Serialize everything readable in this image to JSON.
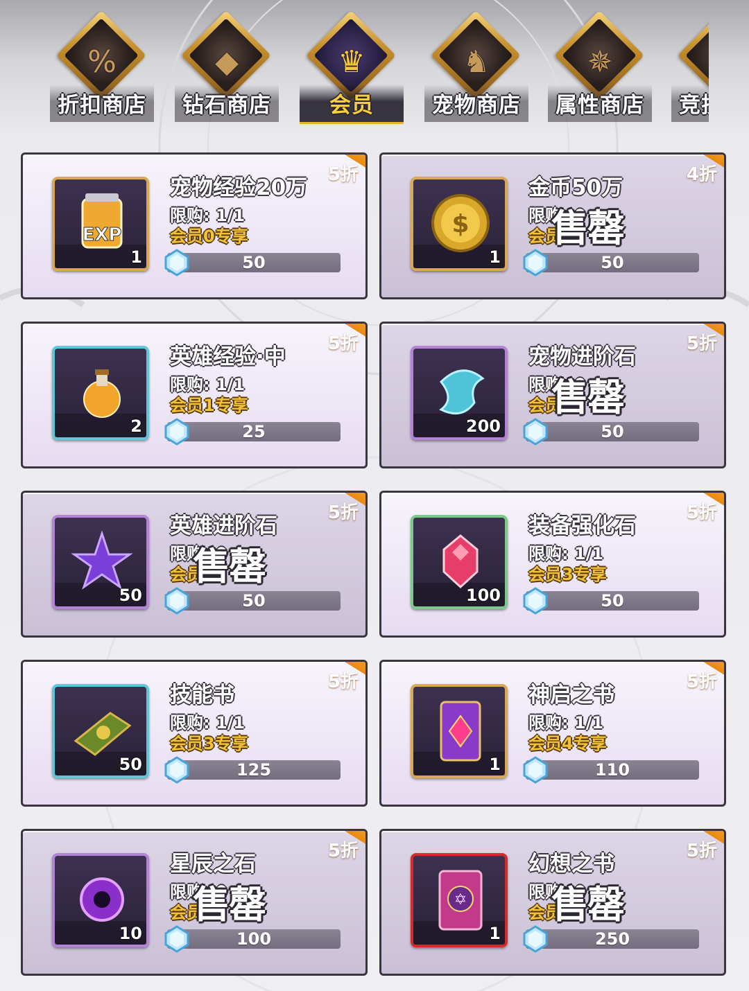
{
  "tabs": [
    {
      "label": "折扣商店",
      "icon": "discount-shop-icon",
      "glyph": "%",
      "active": false
    },
    {
      "label": "钻石商店",
      "icon": "diamond-shop-icon",
      "glyph": "◆",
      "active": false
    },
    {
      "label": "会员",
      "icon": "crown-icon",
      "glyph": "♛",
      "active": true
    },
    {
      "label": "宠物商店",
      "icon": "pet-shop-icon",
      "glyph": "♞",
      "active": false
    },
    {
      "label": "属性商店",
      "icon": "attribute-shop-icon",
      "glyph": "✵",
      "active": false
    },
    {
      "label": "竞技商店",
      "icon": "arena-shop-icon",
      "glyph": "⚔",
      "active": false
    }
  ],
  "items": [
    {
      "name": "宠物经验20万",
      "discount": "5折",
      "limit": "限购: 1/1",
      "vip": "会员0专享",
      "qty": "1",
      "price": "50",
      "sold_out": false,
      "frame": "gold",
      "icon": "exp-jar-icon"
    },
    {
      "name": "金币50万",
      "discount": "4折",
      "limit": "限购: 0",
      "vip": "会员",
      "qty": "1",
      "price": "50",
      "sold_out": true,
      "sold_text": "售罄",
      "frame": "gold",
      "icon": "gold-coin-icon"
    },
    {
      "name": "英雄经验·中",
      "discount": "5折",
      "limit": "限购: 1/1",
      "vip": "会员1专享",
      "qty": "2",
      "price": "25",
      "sold_out": false,
      "frame": "teal",
      "icon": "exp-potion-icon"
    },
    {
      "name": "宠物进阶石",
      "discount": "5折",
      "limit": "限购: 0",
      "vip": "会员",
      "qty": "200",
      "price": "50",
      "sold_out": true,
      "sold_text": "售罄",
      "frame": "purple",
      "icon": "pet-advance-stone-icon"
    },
    {
      "name": "英雄进阶石",
      "discount": "5折",
      "limit": "限购: 0",
      "vip": "会员",
      "qty": "50",
      "price": "50",
      "sold_out": true,
      "sold_text": "售罄",
      "frame": "purple",
      "icon": "hero-advance-stone-icon"
    },
    {
      "name": "装备强化石",
      "discount": "5折",
      "limit": "限购: 1/1",
      "vip": "会员3专享",
      "qty": "100",
      "price": "50",
      "sold_out": false,
      "frame": "green",
      "icon": "enhance-gem-icon"
    },
    {
      "name": "技能书",
      "discount": "5折",
      "limit": "限购: 1/1",
      "vip": "会员3专享",
      "qty": "50",
      "price": "125",
      "sold_out": false,
      "frame": "teal",
      "icon": "skill-book-icon"
    },
    {
      "name": "神启之书",
      "discount": "5折",
      "limit": "限购: 1/1",
      "vip": "会员4专享",
      "qty": "1",
      "price": "110",
      "sold_out": false,
      "frame": "gold",
      "icon": "revelation-book-icon"
    },
    {
      "name": "星辰之石",
      "discount": "5折",
      "limit": "限购: 0",
      "vip": "会员",
      "qty": "10",
      "price": "100",
      "sold_out": true,
      "sold_text": "售罄",
      "frame": "purple",
      "icon": "star-stone-icon"
    },
    {
      "name": "幻想之书",
      "discount": "5折",
      "limit": "限购: 0",
      "vip": "会员",
      "qty": "1",
      "price": "250",
      "sold_out": true,
      "sold_text": "售罄",
      "frame": "red",
      "icon": "fantasy-book-icon"
    }
  ],
  "colors": {
    "ribbon": "#f0941a",
    "vip_text": "#f2c238",
    "active_tab": "#f8cf3a"
  }
}
